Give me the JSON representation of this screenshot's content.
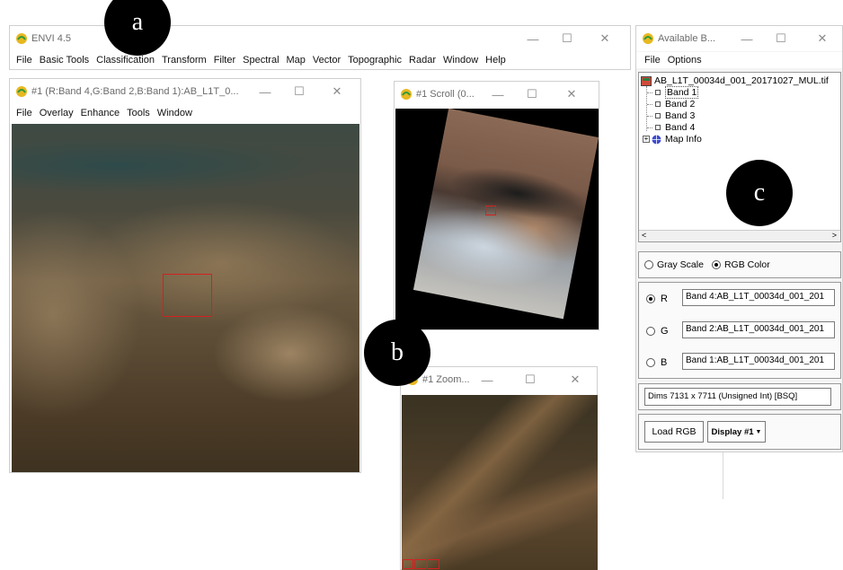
{
  "main_window": {
    "title": "ENVI 4.5",
    "menu": [
      "File",
      "Basic Tools",
      "Classification",
      "Transform",
      "Filter",
      "Spectral",
      "Map",
      "Vector",
      "Topographic",
      "Radar",
      "Window",
      "Help"
    ]
  },
  "image_window": {
    "title": "#1 (R:Band 4,G:Band 2,B:Band 1):AB_L1T_0...",
    "menu": [
      "File",
      "Overlay",
      "Enhance",
      "Tools",
      "Window"
    ]
  },
  "scroll_window": {
    "title": "#1 Scroll (0..."
  },
  "zoom_window": {
    "title": "#1 Zoom..."
  },
  "bands_window": {
    "title": "Available B...",
    "menu": [
      "File",
      "Options"
    ],
    "tree": {
      "file": "AB_L1T_00034d_001_20171027_MUL.tif",
      "bands": [
        "Band 1",
        "Band 2",
        "Band 3",
        "Band 4"
      ],
      "map_info": "Map Info"
    },
    "mode": {
      "gray": "Gray Scale",
      "rgb": "RGB Color",
      "selected": "RGB Color"
    },
    "channels": [
      {
        "label": "R",
        "value": "Band 4:AB_L1T_00034d_001_201"
      },
      {
        "label": "G",
        "value": "Band 2:AB_L1T_00034d_001_201"
      },
      {
        "label": "B",
        "value": "Band 1:AB_L1T_00034d_001_201"
      }
    ],
    "selected_channel": "R",
    "dims": "Dims 7131 x 7711 (Unsigned Int) [BSQ]",
    "load_button": "Load RGB",
    "display_select": "Display #1"
  },
  "callouts": {
    "a": "a",
    "b": "b",
    "c": "c"
  },
  "colors": {
    "roi_box": "#d42020",
    "icon_yellow": "#e8b820",
    "icon_green": "#2e9a3e"
  }
}
